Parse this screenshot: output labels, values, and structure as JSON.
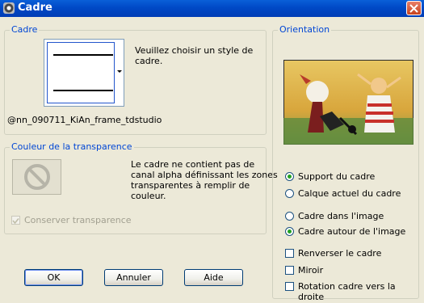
{
  "window": {
    "title": "Cadre"
  },
  "cadre": {
    "legend": "Cadre",
    "instruction": [
      "Veuillez choisir un style de",
      "cadre."
    ],
    "frame_name": "@nn_090711_KiAn_frame_tdstudio"
  },
  "transparence": {
    "legend": "Couleur de la transparence",
    "message": [
      "Le cadre ne contient pas de",
      "canal alpha définissant les zones",
      "transparentes à remplir de",
      "couleur."
    ],
    "preserve_label": "Conserver transparence",
    "preserve_checked": true
  },
  "orientation": {
    "legend": "Orientation",
    "radio_group_1": [
      {
        "label": "Support du cadre",
        "selected": true
      },
      {
        "label": "Calque actuel du cadre",
        "selected": false
      }
    ],
    "radio_group_2": [
      {
        "label": "Cadre dans l'image",
        "selected": false
      },
      {
        "label": "Cadre autour de l'image",
        "selected": true
      }
    ],
    "checkboxes": [
      {
        "label": "Renverser le cadre",
        "checked": false
      },
      {
        "label": "Miroir",
        "checked": false
      },
      {
        "label": "Rotation cadre vers la droite",
        "checked": false
      }
    ]
  },
  "buttons": {
    "ok": "OK",
    "cancel": "Annuler",
    "help": "Aide"
  },
  "colors": {
    "title_bar": "#0049c6",
    "legend": "#0046d5",
    "face": "#ece9d8",
    "radio_dot": "#21a121"
  }
}
